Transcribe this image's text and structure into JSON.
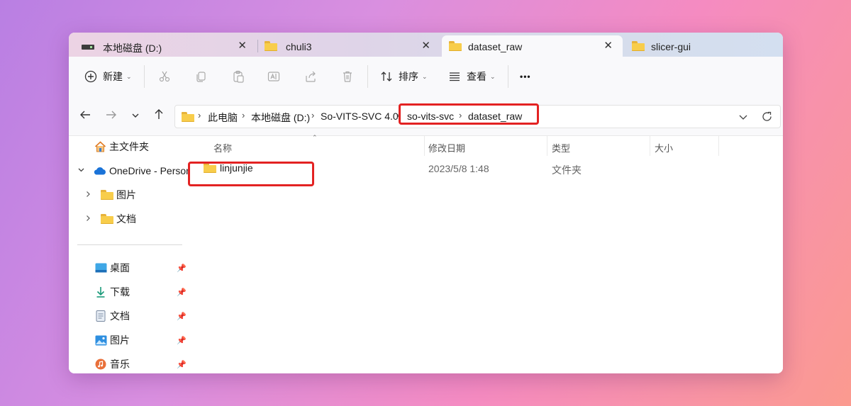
{
  "tabs": [
    {
      "label": "本地磁盘 (D:)",
      "icon": "drive-icon",
      "active": false
    },
    {
      "label": "chuli3",
      "icon": "folder-icon",
      "active": false
    },
    {
      "label": "dataset_raw",
      "icon": "folder-icon",
      "active": true
    },
    {
      "label": "slicer-gui",
      "icon": "folder-icon",
      "active": false
    }
  ],
  "tab_close": "✕",
  "toolbar": {
    "new_label": "新建",
    "sort_label": "排序",
    "view_label": "查看",
    "more_label": "•••"
  },
  "breadcrumb": [
    "此电脑",
    "本地磁盘 (D:)",
    "So-VITS-SVC 4.0",
    "so-vits-svc",
    "dataset_raw"
  ],
  "sidebar": {
    "home": "主文件夹",
    "onedrive": "OneDrive - Person",
    "onedrive_children": [
      "图片",
      "文档"
    ],
    "pinned": [
      "桌面",
      "下载",
      "文档",
      "图片",
      "音乐"
    ]
  },
  "columns": {
    "name": "名称",
    "modified": "修改日期",
    "type": "类型",
    "size": "大小"
  },
  "files": [
    {
      "name": "linjunjie",
      "modified": "2023/5/8 1:48",
      "type": "文件夹",
      "size": ""
    }
  ],
  "colors": {
    "highlight": "#e32222",
    "folder": "#f8cd4b"
  }
}
